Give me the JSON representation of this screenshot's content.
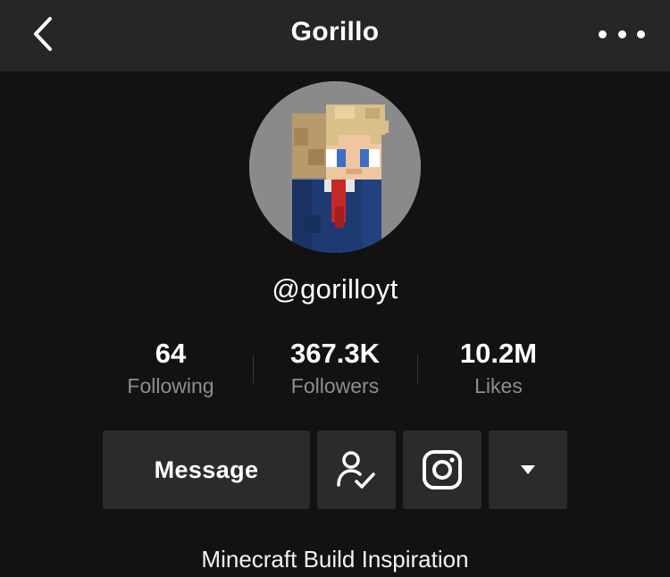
{
  "header": {
    "title": "Gorillo",
    "back_icon": "chevron-left-icon",
    "more_icon": "more-horizontal-icon"
  },
  "profile": {
    "username": "@gorilloyt",
    "bio": "Minecraft Build Inspiration"
  },
  "stats": [
    {
      "value": "64",
      "label": "Following"
    },
    {
      "value": "367.3K",
      "label": "Followers"
    },
    {
      "value": "10.2M",
      "label": "Likes"
    }
  ],
  "actions": {
    "message_label": "Message",
    "follow_status_icon": "user-check-icon",
    "instagram_icon": "instagram-icon",
    "dropdown_icon": "caret-down-icon"
  },
  "colors": {
    "background": "#121212",
    "header": "#262626",
    "button": "#2b2b2b",
    "secondary_text": "#8e8e8e"
  }
}
